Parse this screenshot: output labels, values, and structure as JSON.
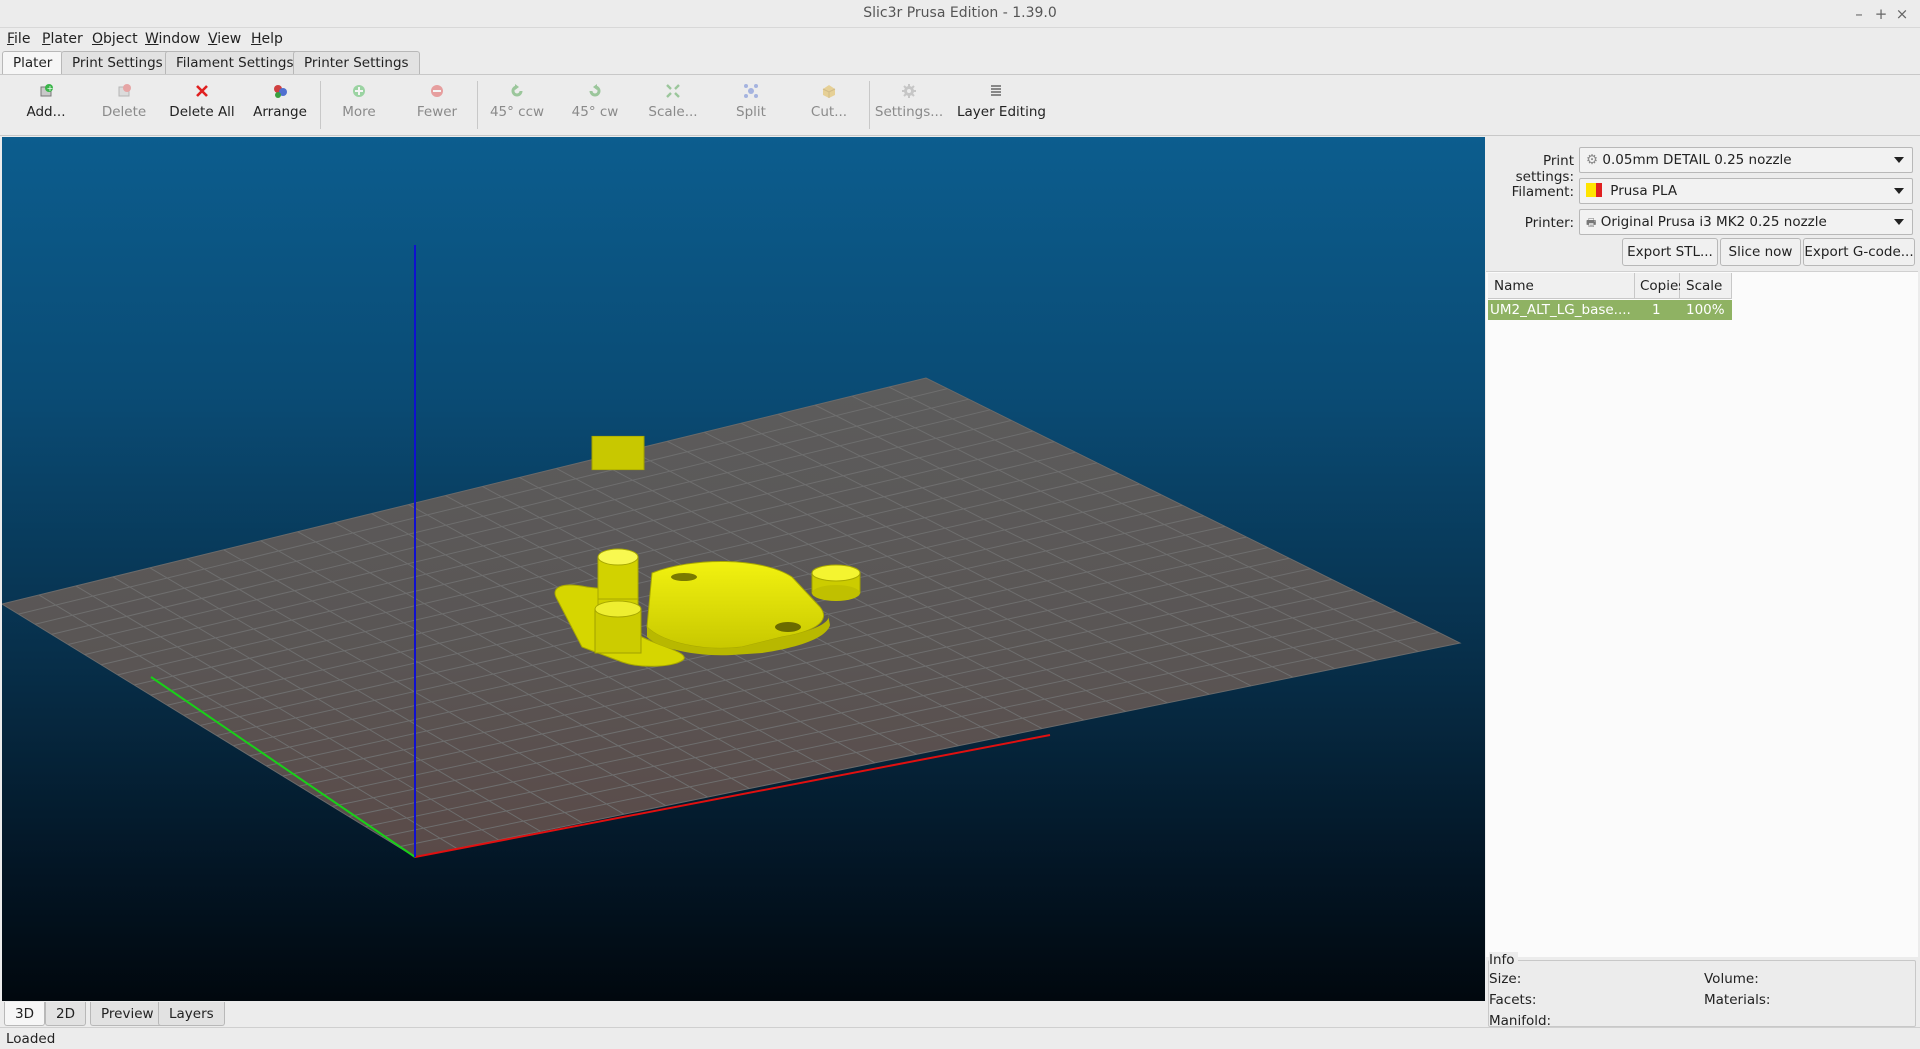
{
  "window": {
    "title": "Slic3r Prusa Edition - 1.39.0",
    "controls": {
      "minimize": "–",
      "maximize": "+",
      "close": "×"
    }
  },
  "menu": [
    "File",
    "Plater",
    "Object",
    "Window",
    "View",
    "Help"
  ],
  "tabs": [
    "Plater",
    "Print Settings",
    "Filament Settings",
    "Printer Settings"
  ],
  "toolbar": {
    "add": "Add...",
    "delete": "Delete",
    "delete_all": "Delete All",
    "arrange": "Arrange",
    "more": "More",
    "fewer": "Fewer",
    "rotate_ccw": "45° ccw",
    "rotate_cw": "45° cw",
    "scale": "Scale...",
    "split": "Split",
    "cut": "Cut...",
    "settings": "Settings...",
    "layer_editing": "Layer Editing"
  },
  "view_tabs": [
    "3D",
    "2D",
    "Preview",
    "Layers"
  ],
  "status": "Loaded",
  "settings": {
    "print_label": "Print settings:",
    "print_value": "0.05mm DETAIL 0.25 nozzle",
    "filament_label": "Filament:",
    "filament_value": "Prusa PLA",
    "printer_label": "Printer:",
    "printer_value": "Original Prusa i3 MK2 0.25 nozzle"
  },
  "actions": {
    "export_stl": "Export STL...",
    "slice_now": "Slice now",
    "export_gcode": "Export G-code..."
  },
  "object_list": {
    "headers": {
      "name": "Name",
      "copies": "Copies",
      "scale": "Scale"
    },
    "rows": [
      {
        "name": "UM2_ALT_LG_base....",
        "copies": "1",
        "scale": "100%"
      }
    ]
  },
  "info": {
    "title": "Info",
    "size": "Size:",
    "volume": "Volume:",
    "facets": "Facets:",
    "materials": "Materials:",
    "manifold": "Manifold:"
  },
  "colors": {
    "object": "#e6e600",
    "x_axis": "#e01010",
    "y_axis": "#18d018",
    "z_axis": "#1010d0",
    "selected_row": "#8fb263",
    "filament_swatch_1": "#ffe400",
    "filament_swatch_2": "#e02020"
  }
}
